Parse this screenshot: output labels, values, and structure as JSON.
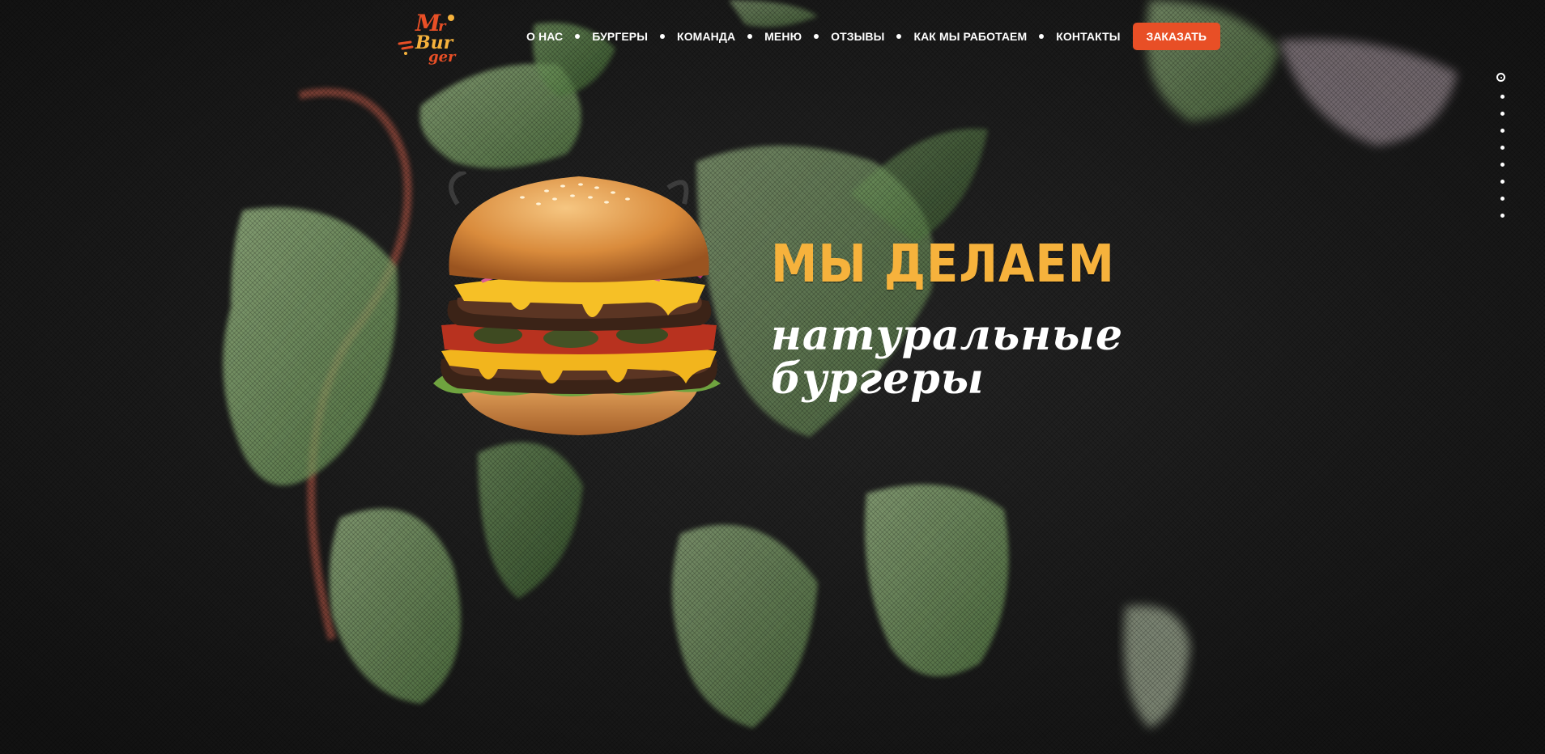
{
  "brand": {
    "logo_text_1": "Mr",
    "logo_text_2": "Bur",
    "logo_text_3": "ger",
    "accent": "#e84f26",
    "yellow": "#f6b23c"
  },
  "nav": {
    "items": [
      {
        "label": "О НАС"
      },
      {
        "label": "БУРГЕРЫ"
      },
      {
        "label": "КОМАНДА"
      },
      {
        "label": "МЕНЮ"
      },
      {
        "label": "ОТЗЫВЫ"
      },
      {
        "label": "КАК МЫ РАБОТАЕМ"
      },
      {
        "label": "КОНТАКТЫ"
      }
    ],
    "order_label": "ЗАКАЗАТЬ"
  },
  "hero": {
    "headline": "МЫ ДЕЛАЕМ",
    "subline_1": "натуральные",
    "subline_2": "бургеры"
  },
  "pagination": {
    "count": 9,
    "active_index": 0
  },
  "icons": {
    "burger": "burger-image",
    "background": "lettuce-leaves-background"
  }
}
